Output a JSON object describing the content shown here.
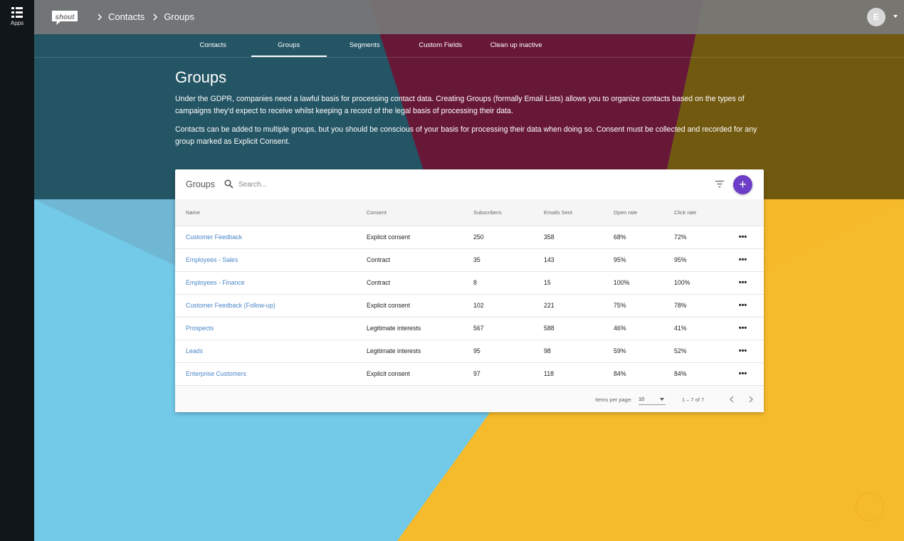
{
  "rail": {
    "apps_label": "Apps",
    "apps_icon": "grid-icon"
  },
  "topbar": {
    "logo_text": "shout",
    "breadcrumb": [
      "Contacts",
      "Groups"
    ],
    "avatar_initial": "E"
  },
  "tabs": [
    {
      "label": "Contacts",
      "active": false
    },
    {
      "label": "Groups",
      "active": true
    },
    {
      "label": "Segments",
      "active": false
    },
    {
      "label": "Custom Fields",
      "active": false
    },
    {
      "label": "Clean up inactive",
      "active": false
    }
  ],
  "intro": {
    "title": "Groups",
    "paragraph1": "Under the GDPR, companies need a lawful basis for processing contact data. Creating Groups (formally Email Lists) allows you to organize contacts based on the types of campaigns they'd expect to receive whilst keeping a record of the legal basis of processing their data.",
    "paragraph2": "Contacts can be added to multiple groups, but you should be conscious of your basis for processing their data when doing so. Consent must be collected and recorded for any group marked as Explicit Consent."
  },
  "card": {
    "title": "Groups",
    "search_placeholder": "Search...",
    "add_label": "+",
    "columns": [
      "Name",
      "Consent",
      "Subscribers",
      "Emails Sent",
      "Open rate",
      "Click rate"
    ],
    "rows": [
      {
        "name": "Customer Feedback",
        "consent": "Explicit consent",
        "subscribers": "250",
        "emails_sent": "358",
        "open_rate": "68%",
        "click_rate": "72%"
      },
      {
        "name": "Employees - Sales",
        "consent": "Contract",
        "subscribers": "35",
        "emails_sent": "143",
        "open_rate": "95%",
        "click_rate": "95%"
      },
      {
        "name": "Employees - Finance",
        "consent": "Contract",
        "subscribers": "8",
        "emails_sent": "15",
        "open_rate": "100%",
        "click_rate": "100%"
      },
      {
        "name": "Customer Feedback (Follow-up)",
        "consent": "Explicit consent",
        "subscribers": "102",
        "emails_sent": "221",
        "open_rate": "75%",
        "click_rate": "78%"
      },
      {
        "name": "Prospects",
        "consent": "Legitimate interests",
        "subscribers": "567",
        "emails_sent": "588",
        "open_rate": "46%",
        "click_rate": "41%"
      },
      {
        "name": "Leads",
        "consent": "Legitimate interests",
        "subscribers": "95",
        "emails_sent": "98",
        "open_rate": "59%",
        "click_rate": "52%"
      },
      {
        "name": "Enterprise Customers",
        "consent": "Explicit consent",
        "subscribers": "97",
        "emails_sent": "118",
        "open_rate": "84%",
        "click_rate": "84%"
      }
    ],
    "row_menu": "•••",
    "footer": {
      "items_per_page_label": "Items per page:",
      "items_per_page_value": "10",
      "range": "1 – 7 of 7"
    }
  },
  "colors": {
    "accent": "#6c3dc6",
    "link": "#4a86c8",
    "bg_blue": "#72c9e8",
    "bg_yellow": "#f6b92a",
    "bg_magenta": "#a8285a"
  }
}
